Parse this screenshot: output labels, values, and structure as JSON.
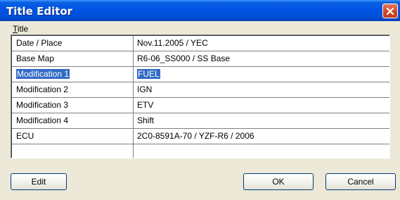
{
  "window": {
    "title": "Title Editor",
    "close_icon": "close-icon"
  },
  "menu": {
    "title_label": "Title"
  },
  "grid": {
    "rows": [
      {
        "label": "Date / Place",
        "value": "Nov.11.2005 / YEC",
        "selected": false
      },
      {
        "label": "Base Map",
        "value": "R6-06_SS000 / SS Base",
        "selected": false
      },
      {
        "label": "Modification 1",
        "value": "FUEL",
        "selected": true
      },
      {
        "label": "Modification 2",
        "value": "IGN",
        "selected": false
      },
      {
        "label": "Modification 3",
        "value": "ETV",
        "selected": false
      },
      {
        "label": "Modification 4",
        "value": "Shift",
        "selected": false
      },
      {
        "label": "ECU",
        "value": "2C0-8591A-70 / YZF-R6 / 2006",
        "selected": false
      }
    ],
    "selection_color": "#316ac5"
  },
  "buttons": {
    "edit_label": "Edit",
    "ok_label": "OK",
    "cancel_label": "Cancel"
  },
  "colors": {
    "titlebar": "#0054e3",
    "window_bg": "#ece9d8",
    "close_button": "#d24722"
  }
}
